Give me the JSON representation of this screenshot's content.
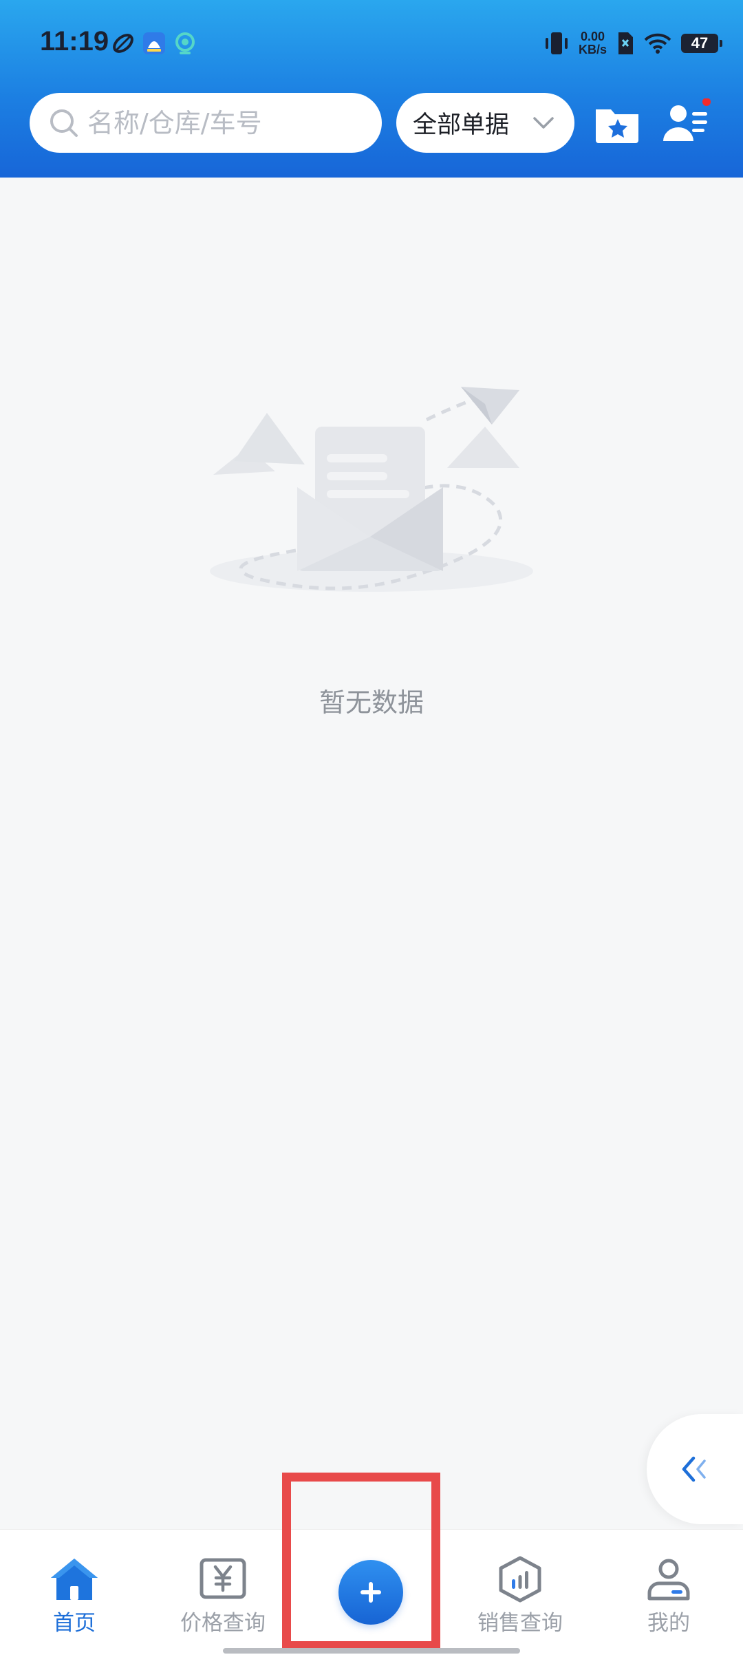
{
  "status_bar": {
    "time": "11:19",
    "net_speed_value": "0.00",
    "net_speed_unit": "KB/s",
    "battery": "47",
    "icons_left": [
      "leaf-app-icon",
      "qq-notify-icon",
      "browser-notify-icon"
    ],
    "icons_right": [
      "vibrate-icon",
      "no-sim-icon",
      "wifi-icon",
      "battery-icon"
    ]
  },
  "header": {
    "search_placeholder": "名称/仓库/车号",
    "filter_label": "全部单据",
    "colors": {
      "gradient_top": "#2aa7ee",
      "gradient_bottom": "#1766d8"
    }
  },
  "main": {
    "empty_text": "暂无数据"
  },
  "bottom_nav": {
    "items": [
      {
        "label": "首页",
        "icon": "home-icon",
        "active": true
      },
      {
        "label": "价格查询",
        "icon": "price-yen-icon",
        "active": false
      },
      {
        "label": "",
        "icon": "plus-icon",
        "active": false
      },
      {
        "label": "销售查询",
        "icon": "sales-chart-icon",
        "active": false
      },
      {
        "label": "我的",
        "icon": "profile-icon",
        "active": false
      }
    ],
    "colors": {
      "active": "#1e6fd8",
      "inactive": "#9ba0a8",
      "highlight": "#e84a4a"
    }
  }
}
